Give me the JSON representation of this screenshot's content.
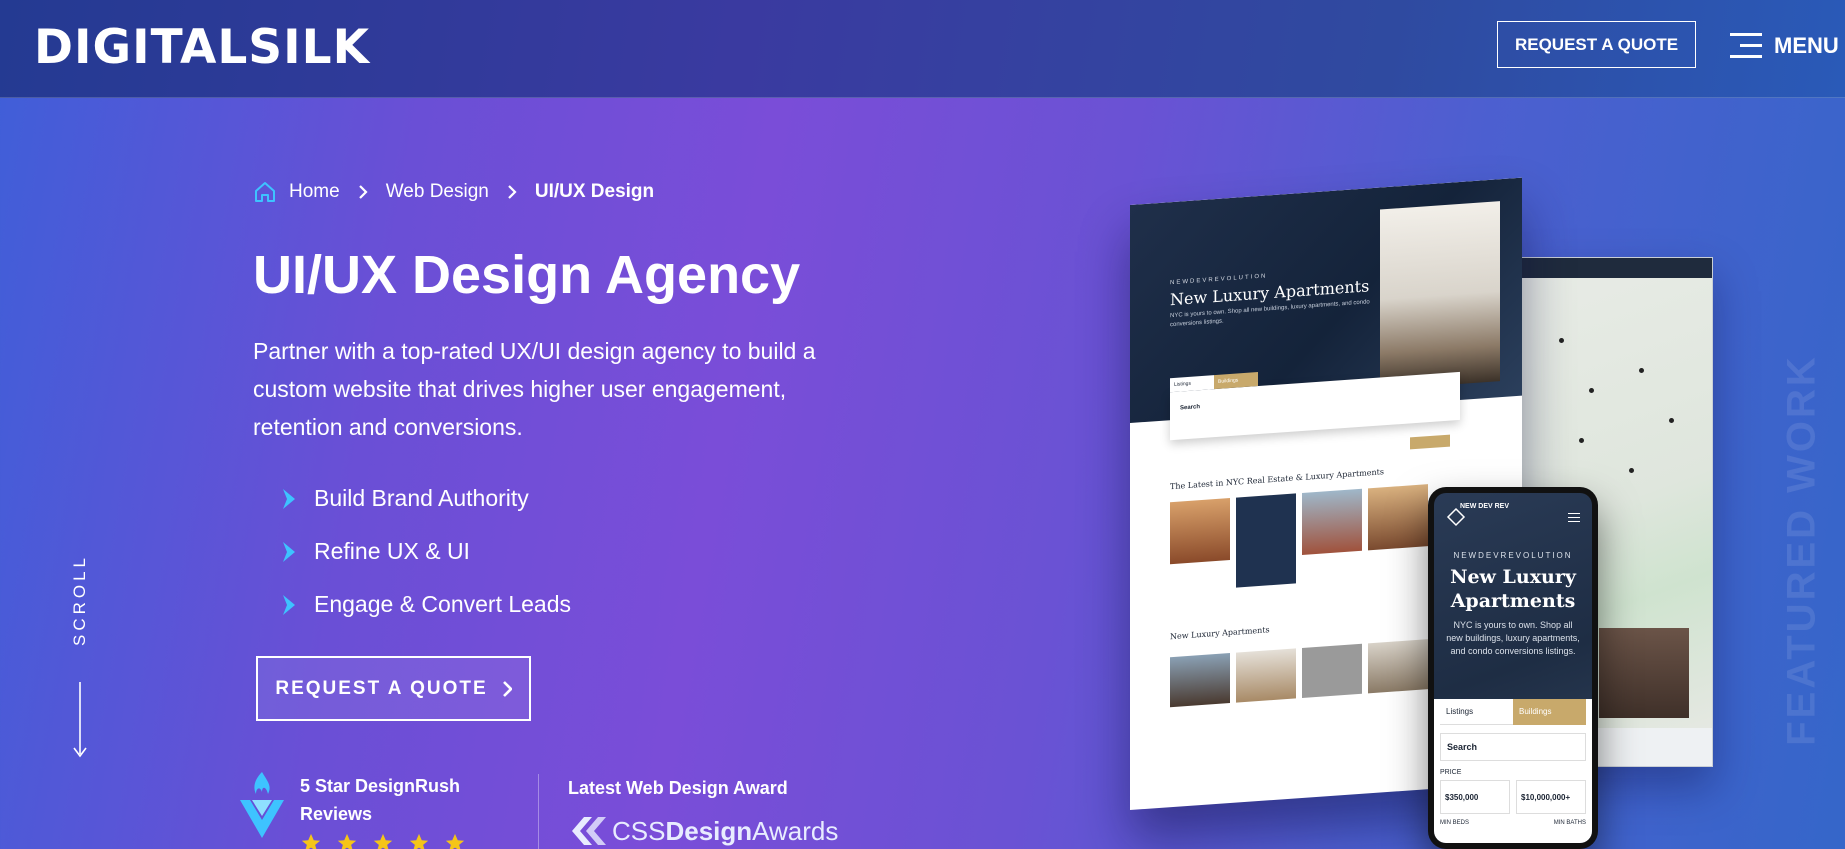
{
  "header": {
    "logo": "DIGITALSILK",
    "quote_button": "REQUEST A QUOTE",
    "menu_label": "MENU"
  },
  "breadcrumb": {
    "items": [
      "Home",
      "Web Design",
      "UI/UX Design"
    ]
  },
  "hero": {
    "title": "UI/UX Design Agency",
    "description": "Partner with a top-rated UX/UI design agency to build a custom website that drives higher user engagement, retention and conversions.",
    "bullets": [
      "Build Brand Authority",
      "Refine UX & UI",
      "Engage & Convert Leads"
    ],
    "cta": "REQUEST A QUOTE"
  },
  "side": {
    "scroll_label": "SCROLL",
    "featured_label": "FEATURED WORK"
  },
  "review": {
    "text": "5 Star DesignRush Reviews",
    "stars": 5
  },
  "award": {
    "title": "Latest Web Design Award",
    "logo_text_1": "CSS",
    "logo_text_2": "Design",
    "logo_text_3": "Awards"
  },
  "mockup": {
    "eyebrow": "NEWDEVREVOLUTION",
    "heading": "New Luxury Apartments",
    "sub": "NYC is yours to own. Shop all new buildings, luxury apartments, and condo conversions listings.",
    "tab_listings": "Listings",
    "tab_buildings": "Buildings",
    "search_label": "Search",
    "latest_heading": "The Latest in NYC Real Estate & Luxury Apartments",
    "luxury_heading": "New Luxury Apartments",
    "phone_logo": "NEW DEV REV",
    "phone_eyebrow": "NEWDEVREVOLUTION",
    "phone_title": "New Luxury Apartments",
    "phone_sub": "NYC is yours to own. Shop all new buildings, luxury apartments, and condo conversions listings.",
    "price_label": "PRICE",
    "min_price": "$350,000",
    "max_price": "$10,000,000+",
    "min_beds": "MIN BEDS",
    "min_baths": "MIN BATHS"
  },
  "colors": {
    "accent_cyan": "#3ec3ff",
    "gold": "#c8a96b",
    "navy": "#1f2f4a"
  }
}
